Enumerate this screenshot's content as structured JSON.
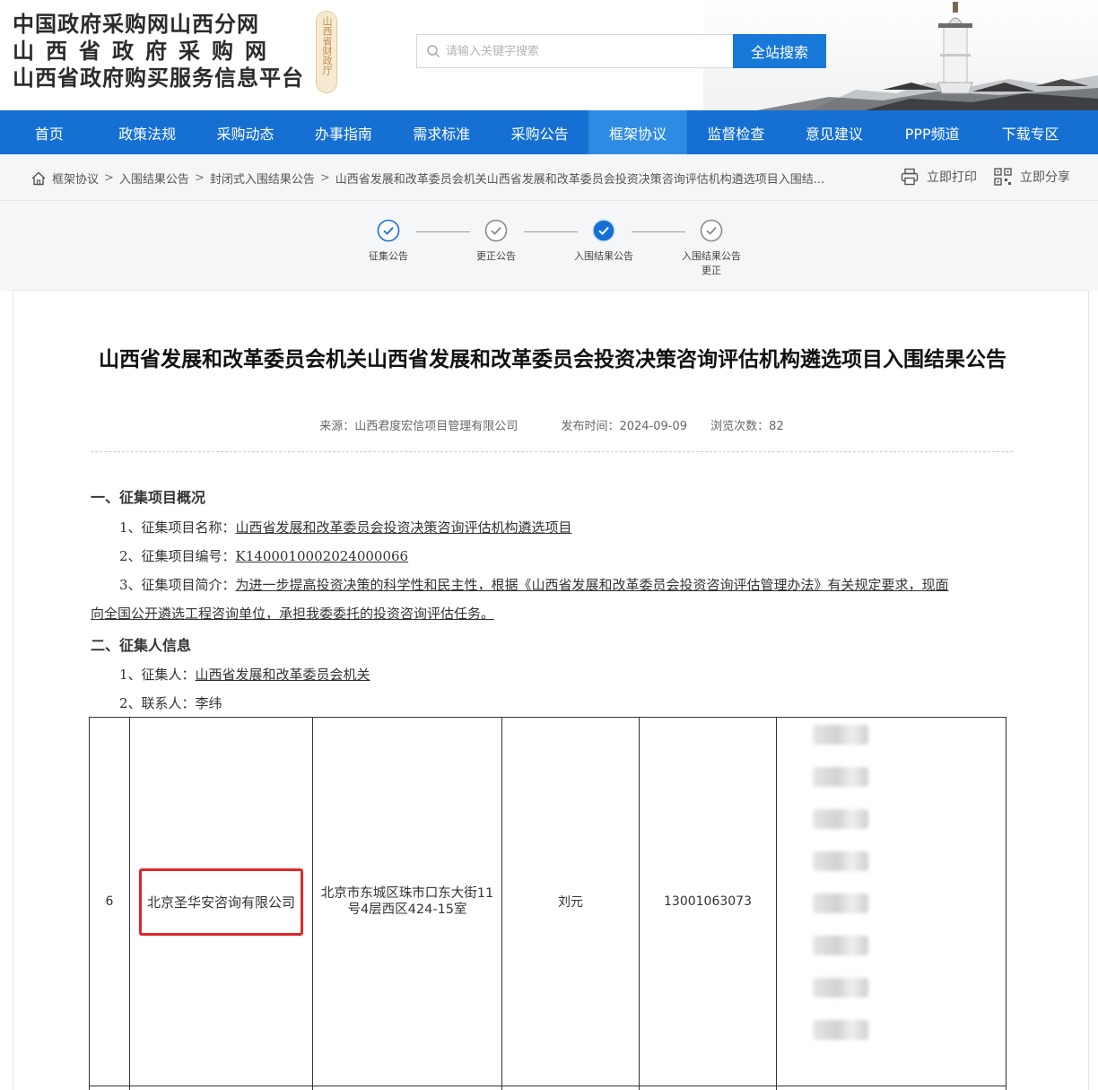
{
  "header": {
    "title_line1": "中国政府采购网山西分网",
    "title_line2": "山西省政府采购网",
    "title_line3": "山西省政府购买服务信息平台",
    "seal_text": "山西省财政厅",
    "search_placeholder": "请输入关键字搜索",
    "search_button": "全站搜索"
  },
  "nav": {
    "items": [
      {
        "label": "首页"
      },
      {
        "label": "政策法规"
      },
      {
        "label": "采购动态"
      },
      {
        "label": "办事指南"
      },
      {
        "label": "需求标准"
      },
      {
        "label": "采购公告"
      },
      {
        "label": "框架协议"
      },
      {
        "label": "监督检查"
      },
      {
        "label": "意见建议"
      },
      {
        "label": "PPP频道"
      },
      {
        "label": "下载专区"
      }
    ],
    "active_index": 6,
    "bar_color": "#1670d3"
  },
  "breadcrumb": {
    "items": [
      "框架协议",
      "入围结果公告",
      "封闭式入围结果公告",
      "山西省发展和改革委员会机关山西省发展和改革委员会投资决策咨询评估机构遴选项目入围结..."
    ],
    "separator": ">",
    "print_label": "立即打印",
    "share_label": "立即分享"
  },
  "steps": [
    {
      "label": "征集公告",
      "state": "done"
    },
    {
      "label": "更正公告",
      "state": "inactive"
    },
    {
      "label": "入围结果公告",
      "state": "current"
    },
    {
      "label": "入围结果公告更正",
      "state": "inactive"
    }
  ],
  "article": {
    "title": "山西省发展和改革委员会机关山西省发展和改革委员会投资决策咨询评估机构遴选项目入围结果公告",
    "source_label": "来源：",
    "source": "山西君度宏信项目管理有限公司",
    "date_label": "发布时间：",
    "date": "2024-09-09",
    "views_label": "浏览次数：",
    "views": "82",
    "section1": "一、征集项目概况",
    "item1_label": "1、征集项目名称：",
    "item1_value": "山西省发展和改革委员会投资决策咨询评估机构遴选项目",
    "item2_label": "2、征集项目编号：",
    "item2_value": "K1400010002024000066",
    "item3_label": "3、征集项目简介：",
    "item3_value_a": "为进一步提高投资决策的科学性和民主性，根据《山西省发展和改革委员会投资咨询评估管理办法》有关规定要求，现面",
    "item3_value_b": "向全国公开遴选工程咨询单位，承担我委委托的投资咨询评估任务。",
    "section2": "二、征集人信息",
    "p1_label": "1、征集人：",
    "p1_value": "山西省发展和改革委员会机关",
    "p2_label": "2、联系人：",
    "p2_value": "李纬"
  },
  "table": {
    "row": {
      "index": "6",
      "company": "北京圣华安咨询有限公司",
      "address": "北京市东城区珠市口东大街11号4层西区424-15室",
      "contact": "刘元",
      "phone": "13001063073"
    },
    "highlight_color": "#e0262a",
    "blurred_cells": 8
  }
}
